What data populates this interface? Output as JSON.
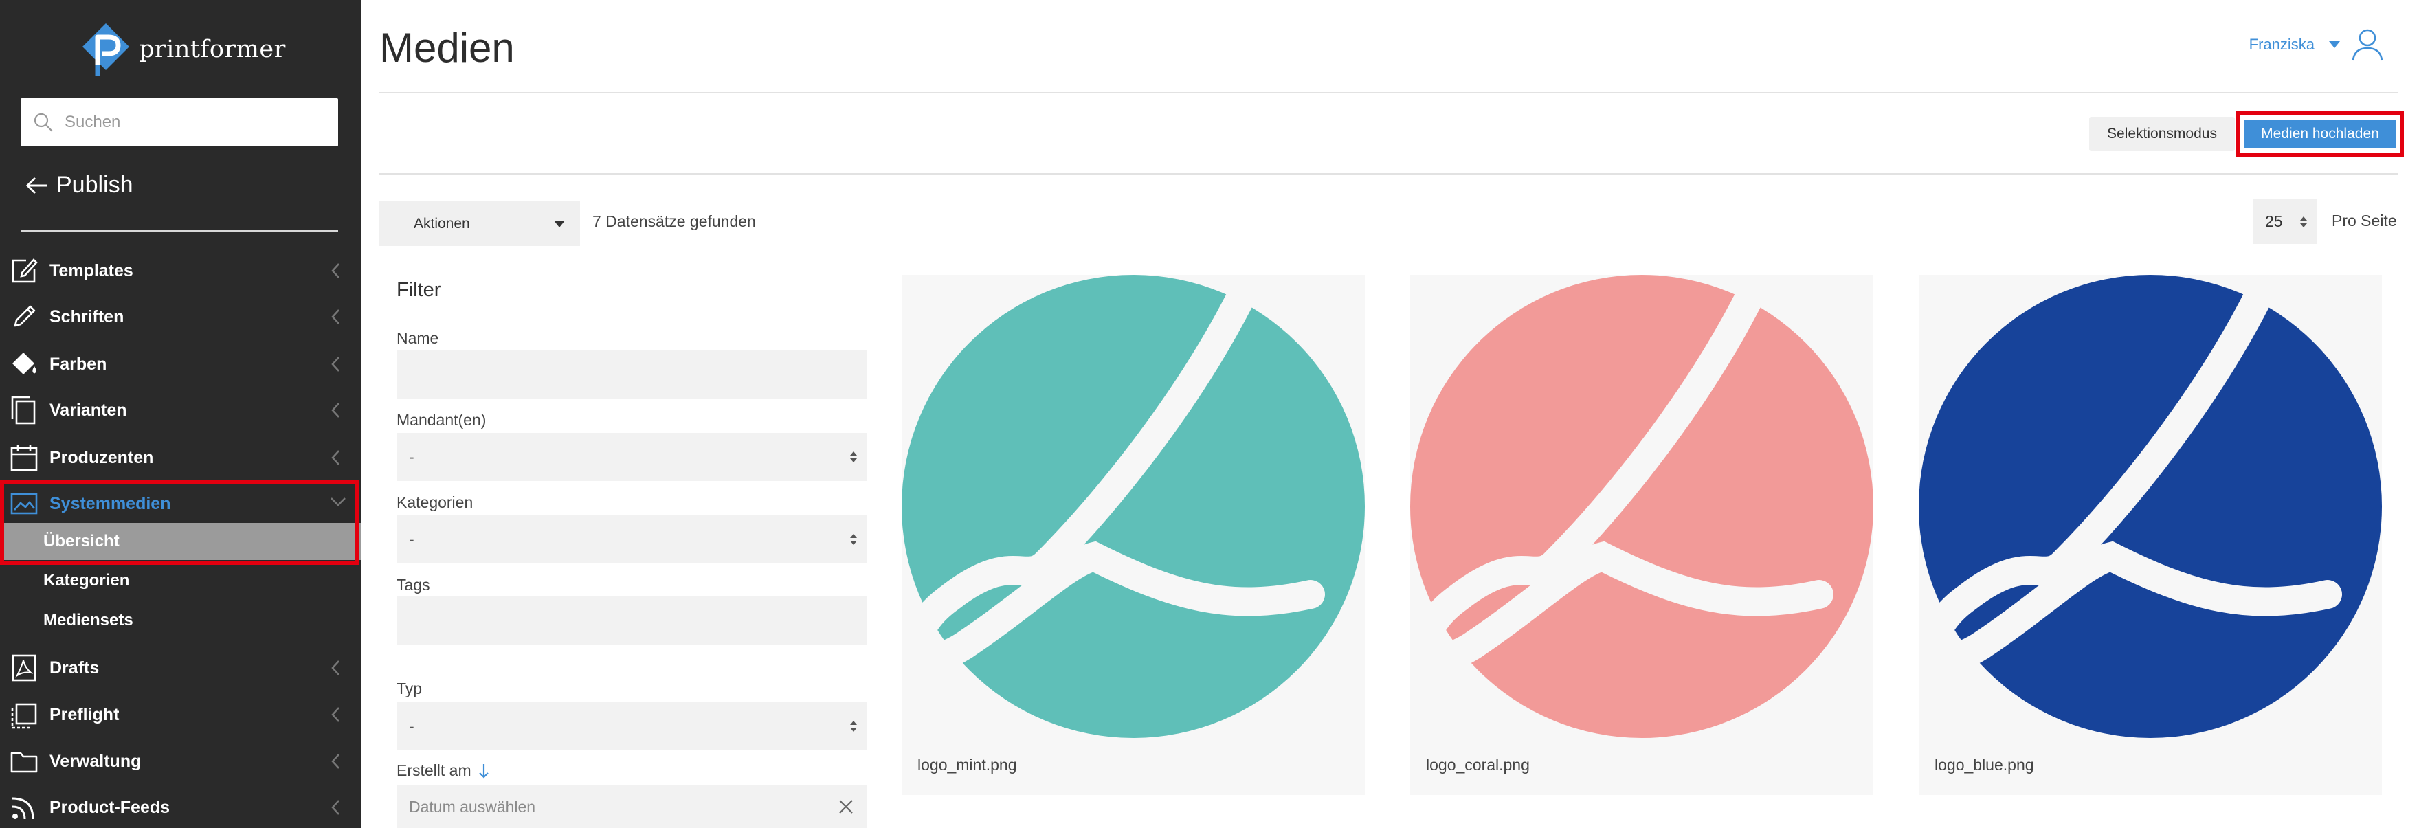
{
  "app": {
    "name": "printformer"
  },
  "sidebar": {
    "search_placeholder": "Suchen",
    "back_label": "Publish",
    "items": [
      {
        "label": "Templates",
        "icon": "edit-icon"
      },
      {
        "label": "Schriften",
        "icon": "pencil-icon"
      },
      {
        "label": "Farben",
        "icon": "paint-bucket-icon"
      },
      {
        "label": "Varianten",
        "icon": "copy-icon"
      },
      {
        "label": "Produzenten",
        "icon": "calendar-icon"
      },
      {
        "label": "Systemmedien",
        "icon": "image-icon",
        "active": true,
        "expanded": true
      },
      {
        "label": "Drafts",
        "icon": "pdf-icon"
      },
      {
        "label": "Preflight",
        "icon": "crop-icon"
      },
      {
        "label": "Verwaltung",
        "icon": "folder-icon"
      },
      {
        "label": "Product-Feeds",
        "icon": "rss-icon"
      }
    ],
    "subitems": [
      {
        "label": "Übersicht",
        "selected": true
      },
      {
        "label": "Kategorien"
      },
      {
        "label": "Mediensets"
      }
    ]
  },
  "header": {
    "title": "Medien",
    "user_name": "Franziska"
  },
  "toolbar": {
    "selection_mode_label": "Selektionsmodus",
    "upload_label": "Medien hochladen"
  },
  "list_controls": {
    "actions_label": "Aktionen",
    "result_count": "7 Datensätze gefunden",
    "per_page_value": "25",
    "per_page_label": "Pro Seite"
  },
  "filter": {
    "title": "Filter",
    "name_label": "Name",
    "mandant_label": "Mandant(en)",
    "mandant_value": "-",
    "kategorien_label": "Kategorien",
    "kategorien_value": "-",
    "tags_label": "Tags",
    "typ_label": "Typ",
    "typ_value": "-",
    "created_label": "Erstellt am",
    "date_placeholder": "Datum auswählen"
  },
  "media": [
    {
      "filename": "logo_mint.png",
      "color": "#5fbfb8"
    },
    {
      "filename": "logo_coral.png",
      "color": "#f29a98"
    },
    {
      "filename": "logo_blue.png",
      "color": "#17439a"
    }
  ],
  "colors": {
    "accent": "#3f8fd8",
    "sidebar_bg": "#2a2a2a",
    "highlight_border": "#e3000f"
  }
}
